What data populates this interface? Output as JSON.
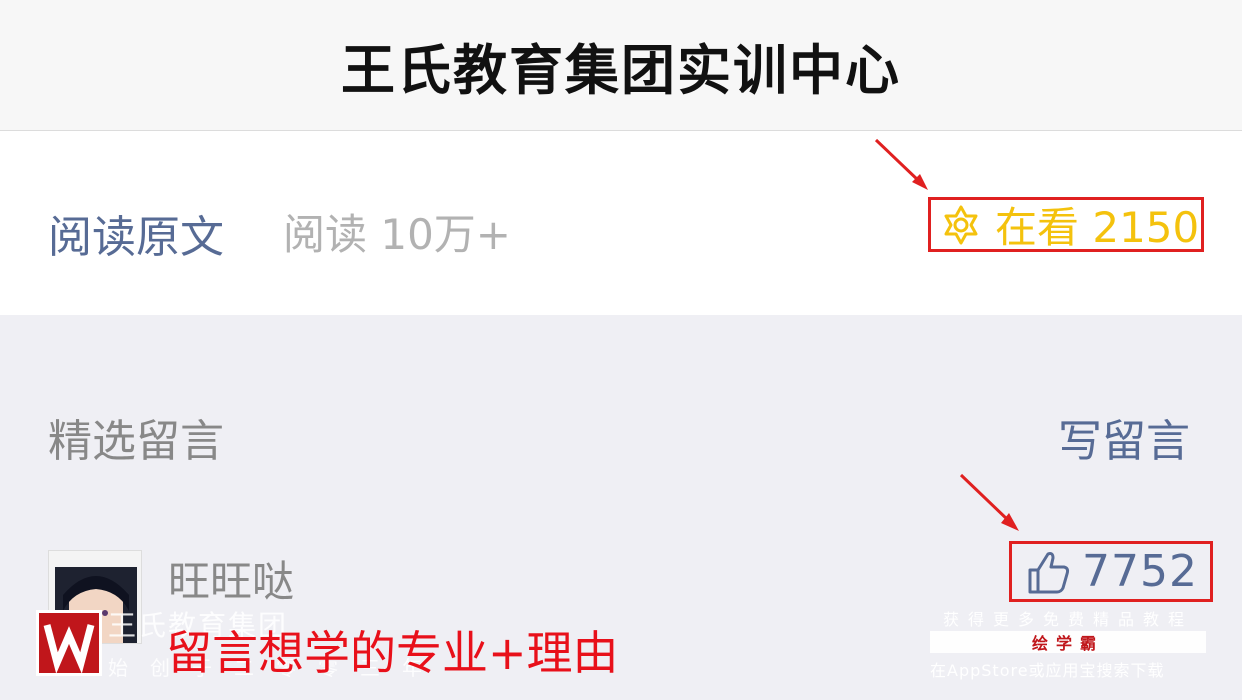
{
  "header": {
    "title": "王氏教育集团实训中心"
  },
  "article_footer": {
    "read_original": "阅读原文",
    "read_count": "阅读 10万+",
    "watching_label": "在看 2150"
  },
  "comments": {
    "section_title": "精选留言",
    "write_label": "写留言",
    "items": [
      {
        "user": "旺旺哒",
        "likes": "7752"
      }
    ]
  },
  "overlay": {
    "watermark_name": "王氏教育集团",
    "watermark_sub": "始创于二零零三年",
    "caption": "留言想学的专业+理由",
    "promo_top": "获得更多免费精品教程",
    "promo_brand": "绘学霸",
    "promo_bottom": "在AppStore或应用宝搜索下载"
  },
  "colors": {
    "link_blue": "#576b95",
    "watching_yellow": "#f4c20d",
    "annotation_red": "#e02020",
    "caption_red": "#e8101a"
  }
}
